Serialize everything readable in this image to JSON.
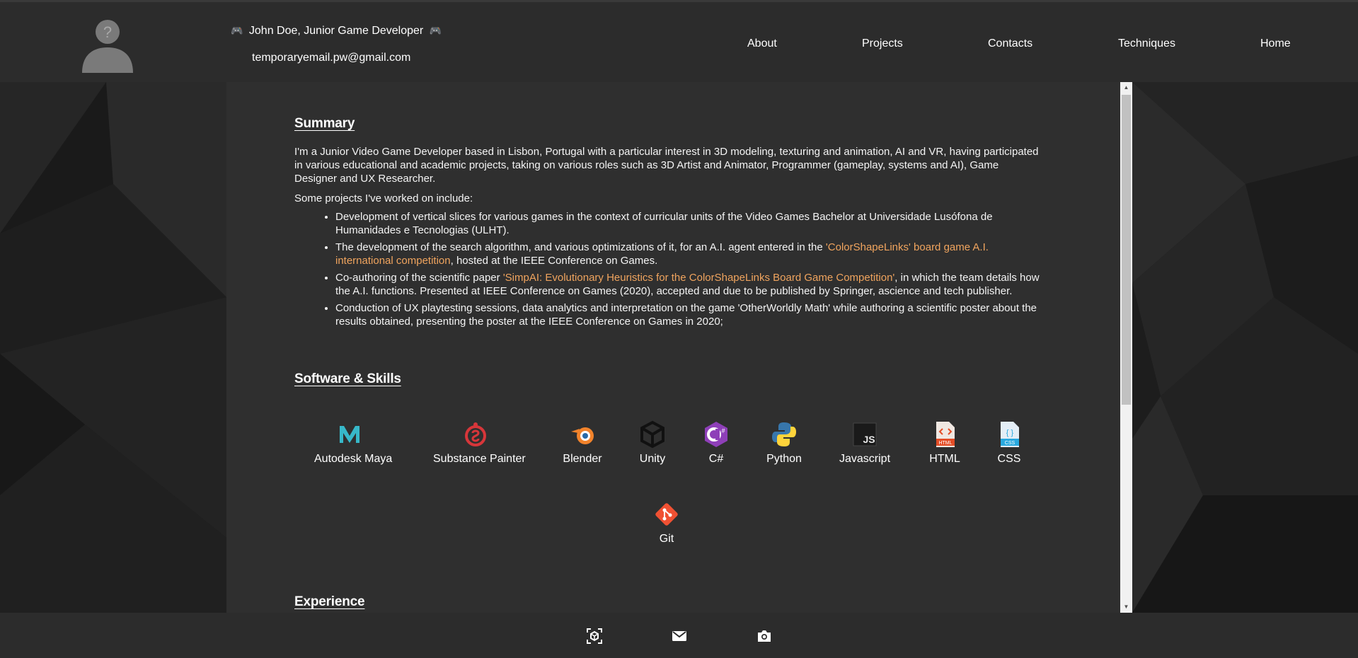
{
  "header": {
    "title": "John Doe, Junior Game Developer",
    "email": "temporaryemail.pw@gmail.com",
    "nav": [
      "About",
      "Projects",
      "Contacts",
      "Techniques",
      "Home"
    ]
  },
  "summary": {
    "heading": "Summary",
    "intro": "I'm a Junior Video Game Developer based in Lisbon, Portugal with a particular interest in 3D modeling, texturing and animation, AI and VR, having participated in various educational and academic projects, taking on various roles such as 3D Artist and Animator, Programmer (gameplay, systems and AI), Game Designer and UX Researcher.",
    "projects_lead": "Some projects I've worked on include:",
    "items": [
      {
        "before": "Development of vertical slices for various games in the context of curricular units of the Video Games Bachelor at Universidade Lusófona de Humanidades e Tecnologias (ULHT).",
        "link": "",
        "after": ""
      },
      {
        "before": "The development of the search algorithm, and various optimizations of it, for an A.I. agent entered in the ",
        "link": "'ColorShapeLinks' board game A.I. international competition",
        "after": ", hosted at the IEEE Conference on Games."
      },
      {
        "before": "Co-authoring of the scientific paper ",
        "link": "'SimpAI: Evolutionary Heuristics for the ColorShapeLinks Board Game Competition'",
        "after": ", in which the team details how the A.I. functions. Presented at IEEE Conference on Games (2020), accepted and due to be published by Springer, ascience and tech publisher."
      },
      {
        "before": "Conduction of UX playtesting sessions, data analytics and interpretation on the game 'OtherWorldly Math' while authoring a scientific poster about the results obtained, presenting the poster at the IEEE Conference on Games in 2020;",
        "link": "",
        "after": ""
      }
    ]
  },
  "skills": {
    "heading": "Software & Skills",
    "items": [
      {
        "label": "Autodesk Maya",
        "icon": "maya-icon"
      },
      {
        "label": "Substance Painter",
        "icon": "substance-painter-icon"
      },
      {
        "label": "Blender",
        "icon": "blender-icon"
      },
      {
        "label": "Unity",
        "icon": "unity-icon"
      },
      {
        "label": "C#",
        "icon": "csharp-icon"
      },
      {
        "label": "Python",
        "icon": "python-icon"
      },
      {
        "label": "Javascript",
        "icon": "javascript-icon"
      },
      {
        "label": "HTML",
        "icon": "html-icon"
      },
      {
        "label": "CSS",
        "icon": "css-icon"
      },
      {
        "label": "Git",
        "icon": "git-icon"
      }
    ]
  },
  "experience": {
    "heading": "Experience"
  },
  "footer": {
    "icons": [
      "augmented-reality-icon",
      "mail-icon",
      "camera-icon"
    ]
  },
  "colors": {
    "link": "#f0a45e",
    "panel": "#2f2f2f",
    "header": "#2c2c2c"
  }
}
